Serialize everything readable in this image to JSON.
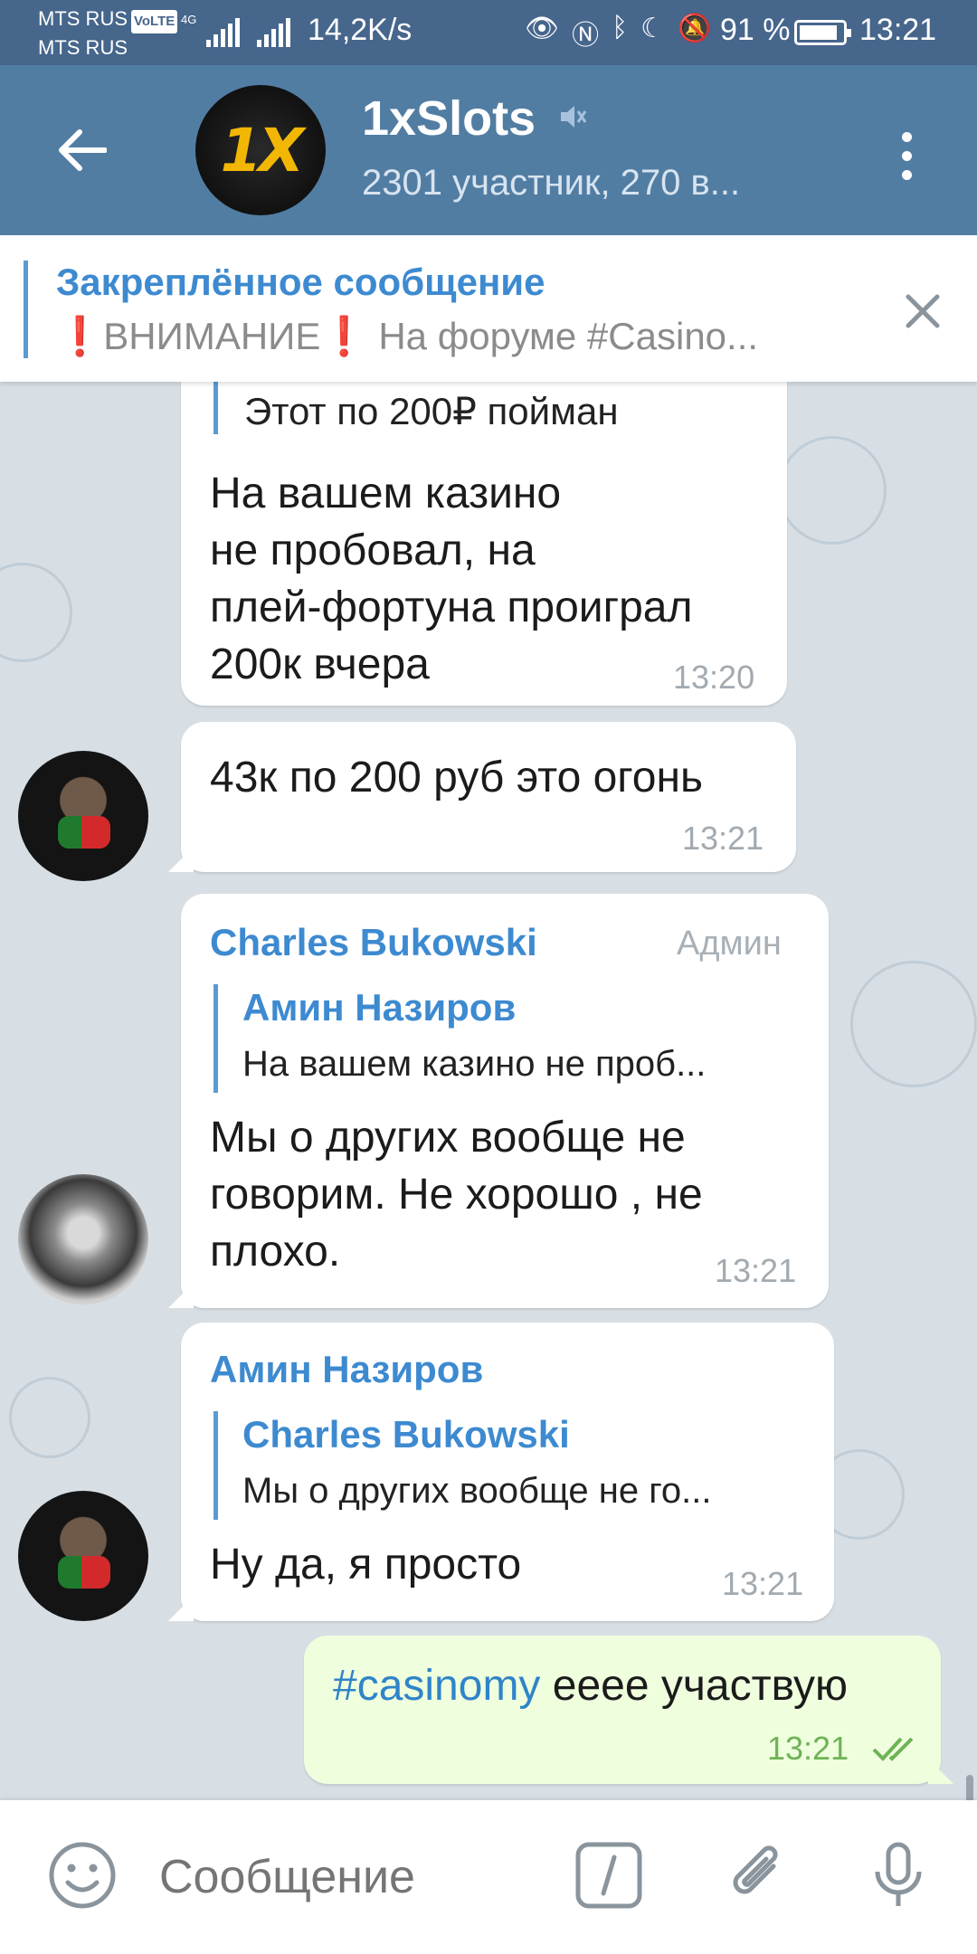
{
  "status_bar": {
    "carrier1": "MTS RUS",
    "volte": "VoLTE",
    "carrier2": "MTS RUS",
    "network": "4G",
    "speed": "14,2K/s",
    "battery": "91 %",
    "time": "13:21"
  },
  "header": {
    "title": "1xSlots",
    "avatar_logo": "1X",
    "subtitle": "2301 участник, 270 в..."
  },
  "pinned": {
    "title": "Закреплённое сообщение",
    "excl": "❗",
    "text_word": "ВНИМАНИЕ",
    "text_rest": "На форуме #Casino..."
  },
  "messages": [
    {
      "quote": "Этот по 200₽ пойман",
      "text": "На вашем казино\nне пробовал, на\nплей-фортуна проиграл\n200к вчера",
      "time": "13:20"
    },
    {
      "text": "43к по 200 руб это огонь",
      "time": "13:21"
    },
    {
      "sender": "Charles Bukowski",
      "badge": "Админ",
      "reply_name": "Амин Назиров",
      "reply_text": "На вашем казино не проб...",
      "text": "Мы о других вообще не\nговорим. Не хорошо , не\nплохо.",
      "time": "13:21"
    },
    {
      "sender": "Амин Назиров",
      "reply_name": "Charles Bukowski",
      "reply_text": "Мы о других вообще не го...",
      "text": "Ну да, я просто",
      "time": "13:21"
    },
    {
      "hashtag": "#casinomy",
      "text": " ееее участвую",
      "time": "13:21"
    }
  ],
  "input": {
    "placeholder": "Сообщение"
  },
  "colors": {
    "header": "#527da3",
    "status_bar": "#46668c",
    "link": "#3d8ad0",
    "outgoing_bubble": "#efffde"
  },
  "icons": [
    "back-arrow-icon",
    "mute-icon",
    "more-vert-icon",
    "close-icon",
    "emoji-icon",
    "bot-command-icon",
    "attach-icon",
    "microphone-icon",
    "double-check-icon"
  ]
}
